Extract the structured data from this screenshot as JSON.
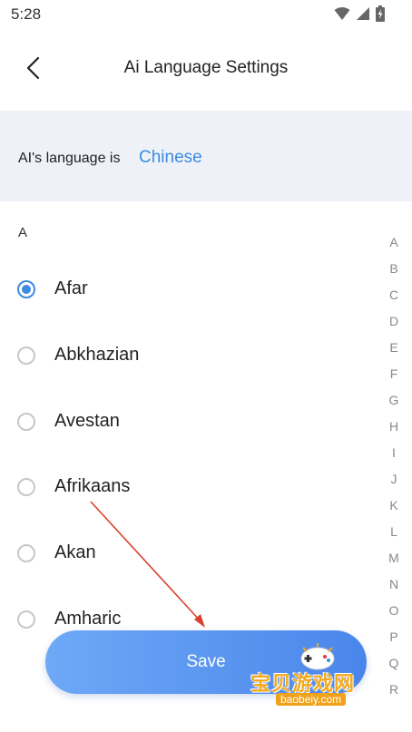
{
  "status_bar": {
    "time": "5:28",
    "icons": [
      "wifi-icon",
      "signal-icon",
      "battery-icon"
    ]
  },
  "header": {
    "title": "Ai Language Settings",
    "back_icon": "chevron-left-icon"
  },
  "current_language": {
    "label": "AI's language is",
    "value": "Chinese"
  },
  "section_letter": "A",
  "languages": [
    {
      "label": "Afar",
      "selected": true
    },
    {
      "label": "Abkhazian",
      "selected": false
    },
    {
      "label": "Avestan",
      "selected": false
    },
    {
      "label": "Afrikaans",
      "selected": false
    },
    {
      "label": "Akan",
      "selected": false
    },
    {
      "label": "Amharic",
      "selected": false
    }
  ],
  "alphabet_index": [
    "A",
    "B",
    "C",
    "D",
    "E",
    "F",
    "G",
    "H",
    "I",
    "J",
    "K",
    "L",
    "M",
    "N",
    "O",
    "P",
    "Q",
    "R"
  ],
  "save_button": {
    "label": "Save"
  },
  "watermark": {
    "text": "宝贝游戏网",
    "url": "baobeiy.com"
  },
  "colors": {
    "accent": "#3c8be0",
    "panel_bg": "#eef2f8",
    "button_gradient_start": "#6ea8f7",
    "button_gradient_end": "#4a86ea",
    "watermark_orange": "#f3a91c"
  }
}
